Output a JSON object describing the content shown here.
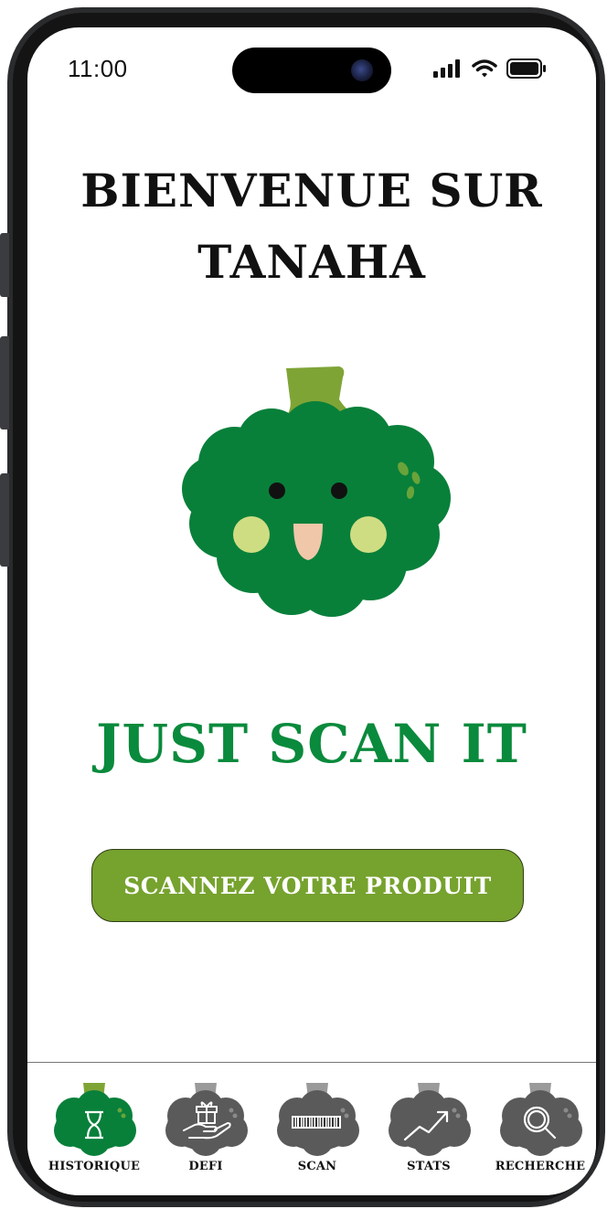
{
  "status_bar": {
    "time": "11:00",
    "icons": [
      "cellular-signal-icon",
      "wifi-icon",
      "battery-icon"
    ]
  },
  "header": {
    "title_line1": "BIENVENUE SUR",
    "title_line2": "TANAHA"
  },
  "mascot": {
    "icon": "broccoli-mascot-icon"
  },
  "tagline": "JUST SCAN IT",
  "scan_button": {
    "label": "SCANNEZ VOTRE PRODUIT"
  },
  "bottom_nav": {
    "items": [
      {
        "label": "HISTORIQUE",
        "icon": "hourglass-icon",
        "active": true
      },
      {
        "label": "DEFI",
        "icon": "gift-hand-icon",
        "active": false
      },
      {
        "label": "SCAN",
        "icon": "barcode-icon",
        "active": false
      },
      {
        "label": "STATS",
        "icon": "trend-arrow-icon",
        "active": false
      },
      {
        "label": "RECHERCHE",
        "icon": "magnifier-icon",
        "active": false
      }
    ]
  },
  "colors": {
    "brand_green": "#0a8a3c",
    "button_green": "#76a22e",
    "stem_green": "#7fa436",
    "inactive_gray": "#5a5a5a",
    "phone_frame": "#2a2b2d"
  }
}
